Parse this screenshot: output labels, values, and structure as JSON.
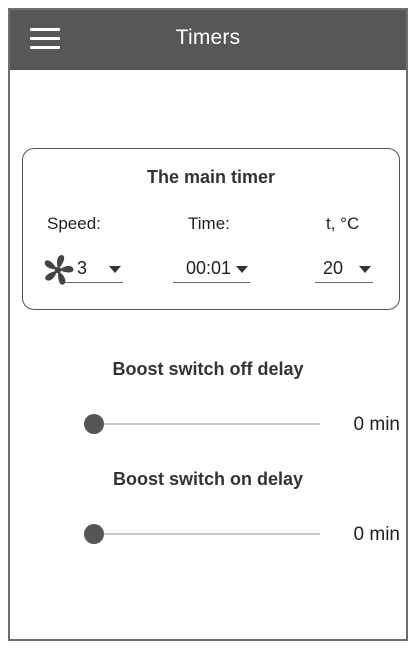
{
  "header": {
    "title": "Timers",
    "menu_icon": "hamburger-menu-icon"
  },
  "main_timer": {
    "title": "The main timer",
    "speed_label": "Speed:",
    "time_label": "Time:",
    "temp_label": "t, °C",
    "speed_value": "3",
    "time_value": "00:01",
    "temp_value": "20",
    "fan_icon": "fan-icon"
  },
  "boost_off": {
    "title": "Boost switch off delay",
    "value": "0 min",
    "level": 0
  },
  "boost_on": {
    "title": "Boost switch on delay",
    "value": "0 min",
    "level": 0
  },
  "colors": {
    "appbar": "#575757",
    "thumb": "#555555",
    "track": "#c9c9c9"
  }
}
